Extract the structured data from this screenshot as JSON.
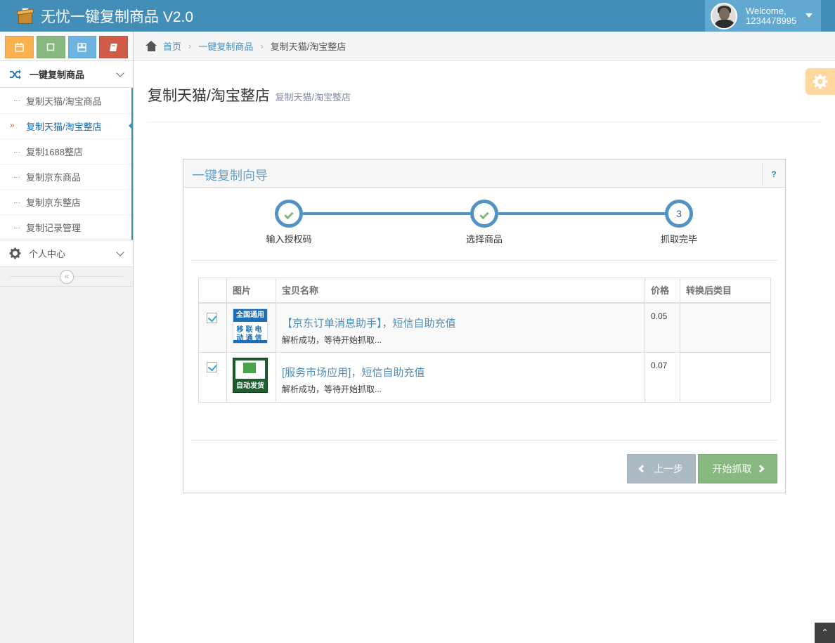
{
  "app": {
    "title": "无忧一键复制商品 V2.0"
  },
  "user": {
    "welcome": "Welcome,",
    "id": "1234478995"
  },
  "sidebar": {
    "shortcuts": [
      {
        "icon": "calendar-icon",
        "color": "#fbb14f"
      },
      {
        "icon": "square-icon",
        "color": "#87b87f"
      },
      {
        "icon": "grid-icon",
        "color": "#6fb3e0"
      },
      {
        "icon": "book-icon",
        "color": "#d15b47"
      }
    ],
    "menu1": {
      "label": "一键复制商品",
      "icon": "shuffle-icon"
    },
    "items": [
      {
        "label": "复制天猫/淘宝商品"
      },
      {
        "label": "复制天猫/淘宝整店"
      },
      {
        "label": "复制1688整店"
      },
      {
        "label": "复制京东商品"
      },
      {
        "label": "复制京东整店"
      },
      {
        "label": "复制记录管理"
      }
    ],
    "menu2": {
      "label": "个人中心",
      "icon": "gear-icon"
    }
  },
  "breadcrumb": {
    "home": "首页",
    "level1": "一键复制商品",
    "current": "复制天猫/淘宝整店"
  },
  "page": {
    "title": "复制天猫/淘宝整店",
    "subtitle": "复制天猫/淘宝整店"
  },
  "wizard": {
    "title": "一键复制向导",
    "help": "?",
    "steps": [
      {
        "label": "输入授权码",
        "state": "done"
      },
      {
        "label": "选择商品",
        "state": "done"
      },
      {
        "label": "抓取完毕",
        "state": "current",
        "number": "3"
      }
    ],
    "table": {
      "headers": [
        "图片",
        "宝贝名称",
        "价格",
        "转换后类目"
      ],
      "rows": [
        {
          "checked": true,
          "thumb_top": "全国通用",
          "thumb_line1": "移联电",
          "thumb_line2": "动通信",
          "name": "【京东订单消息助手】，短信自助充值",
          "status": "解析成功，等待开始抓取...",
          "price": "0.05",
          "category": ""
        },
        {
          "checked": true,
          "thumb_text": "自动发货",
          "name": "[服务市场应用]，短信自助充值",
          "status": "解析成功，等待开始抓取...",
          "price": "0.07",
          "category": ""
        }
      ]
    },
    "buttons": {
      "prev": "上一步",
      "next": "开始抓取"
    }
  },
  "colors": {
    "navbar": "#438eb9",
    "accent": "#5293c4",
    "success": "#87b87f",
    "muted_button": "#abbac3"
  }
}
